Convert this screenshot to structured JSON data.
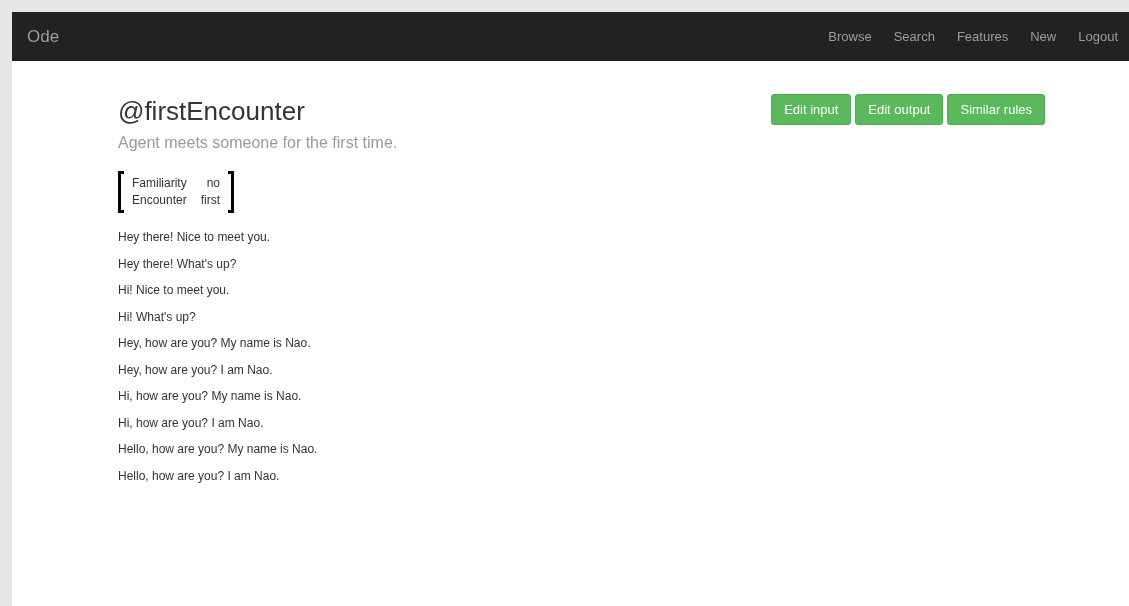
{
  "navbar": {
    "brand": "Ode",
    "links": [
      "Browse",
      "Search",
      "Features",
      "New",
      "Logout"
    ]
  },
  "rule": {
    "title": "@firstEncounter",
    "description": "Agent meets someone for the first time.",
    "buttons": [
      "Edit input",
      "Edit output",
      "Similar rules"
    ],
    "features": [
      {
        "name": "Familiarity",
        "value": "no"
      },
      {
        "name": "Encounter",
        "value": "first"
      }
    ],
    "outputs": [
      "Hey there! Nice to meet you.",
      "Hey there! What's up?",
      "Hi! Nice to meet you.",
      "Hi! What's up?",
      "Hey, how are you? My name is Nao.",
      "Hey, how are you? I am Nao.",
      "Hi, how are you? My name is Nao.",
      "Hi, how are you? I am Nao.",
      "Hello, how are you? My name is Nao.",
      "Hello, how are you? I am Nao."
    ]
  }
}
